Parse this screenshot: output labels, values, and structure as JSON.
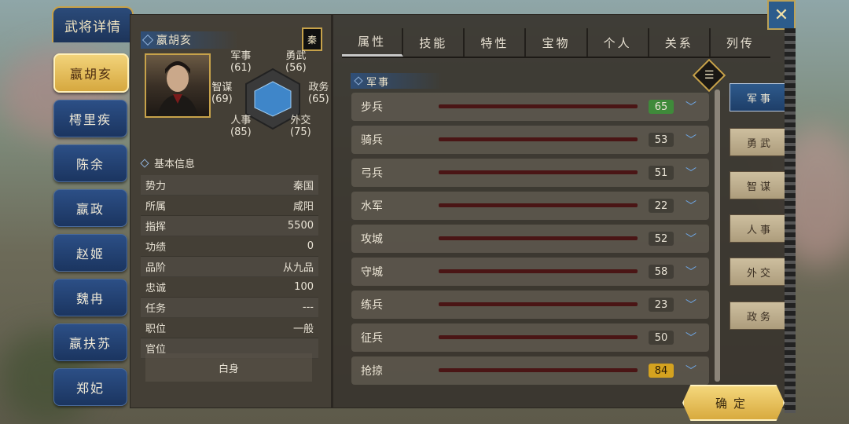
{
  "header": {
    "title": "武将详情"
  },
  "characters": [
    {
      "name": "嬴胡亥",
      "active": true
    },
    {
      "name": "樗里疾",
      "active": false
    },
    {
      "name": "陈余",
      "active": false
    },
    {
      "name": "嬴政",
      "active": false
    },
    {
      "name": "赵姬",
      "active": false
    },
    {
      "name": "魏冉",
      "active": false
    },
    {
      "name": "嬴扶苏",
      "active": false
    },
    {
      "name": "郑妃",
      "active": false
    }
  ],
  "profile": {
    "name": "嬴胡亥",
    "faction_badge": "秦",
    "stats": {
      "military": {
        "label": "军事",
        "value": "(61)"
      },
      "valor": {
        "label": "勇武",
        "value": "(56)"
      },
      "strategy": {
        "label": "智谋",
        "value": "(69)"
      },
      "politics": {
        "label": "政务",
        "value": "(65)"
      },
      "personnel": {
        "label": "人事",
        "value": "(85)"
      },
      "diplomacy": {
        "label": "外交",
        "value": "(75)"
      }
    }
  },
  "info": {
    "heading": "基本信息",
    "rows": [
      {
        "label": "势力",
        "value": "秦国"
      },
      {
        "label": "所属",
        "value": "咸阳"
      },
      {
        "label": "指挥",
        "value": "5500"
      },
      {
        "label": "功绩",
        "value": "0"
      },
      {
        "label": "品阶",
        "value": "从九品"
      },
      {
        "label": "忠诚",
        "value": "100"
      },
      {
        "label": "任务",
        "value": "---"
      },
      {
        "label": "职位",
        "value": "一般"
      },
      {
        "label": "官位",
        "value": ""
      }
    ],
    "status": "白身"
  },
  "tabs": [
    {
      "label": "属性",
      "active": true
    },
    {
      "label": "技能",
      "active": false
    },
    {
      "label": "特性",
      "active": false
    },
    {
      "label": "宝物",
      "active": false
    },
    {
      "label": "个人",
      "active": false
    },
    {
      "label": "关系",
      "active": false
    },
    {
      "label": "列传",
      "active": false
    }
  ],
  "section": {
    "title": "军事"
  },
  "skills": [
    {
      "name": "步兵",
      "value": "65",
      "highlight": "green"
    },
    {
      "name": "骑兵",
      "value": "53",
      "highlight": "none"
    },
    {
      "name": "弓兵",
      "value": "51",
      "highlight": "none"
    },
    {
      "name": "水军",
      "value": "22",
      "highlight": "none"
    },
    {
      "name": "攻城",
      "value": "52",
      "highlight": "none"
    },
    {
      "name": "守城",
      "value": "58",
      "highlight": "none"
    },
    {
      "name": "练兵",
      "value": "23",
      "highlight": "none"
    },
    {
      "name": "征兵",
      "value": "50",
      "highlight": "none"
    },
    {
      "name": "抢掠",
      "value": "84",
      "highlight": "gold"
    }
  ],
  "categories": [
    {
      "label": "军事",
      "active": true
    },
    {
      "label": "勇武",
      "active": false
    },
    {
      "label": "智谋",
      "active": false
    },
    {
      "label": "人事",
      "active": false
    },
    {
      "label": "外交",
      "active": false
    },
    {
      "label": "政务",
      "active": false
    }
  ],
  "confirm_label": "确定",
  "icons": {
    "close": "crossed-tools-icon",
    "list": "list-icon",
    "expand": "chevron-down-icon"
  },
  "colors": {
    "highlight_green": "#3f8a3a",
    "highlight_gold": "#d4a21f",
    "accent_blue": "#2b4b7a",
    "gold_frame": "#c7a24a"
  }
}
